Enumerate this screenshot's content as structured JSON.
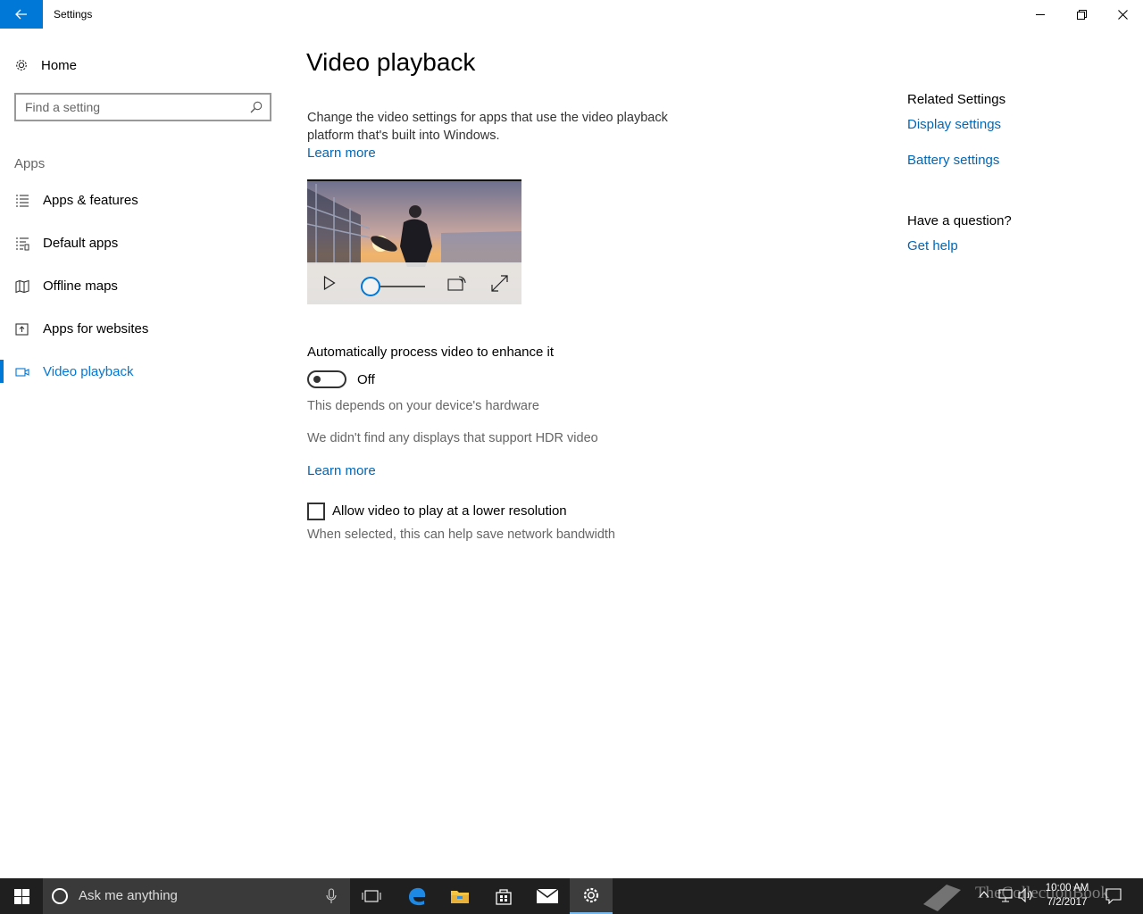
{
  "window": {
    "title": "Settings"
  },
  "sidebar": {
    "home_label": "Home",
    "search_placeholder": "Find a setting",
    "section_label": "Apps",
    "items": [
      {
        "label": "Apps & features",
        "icon": "list-icon"
      },
      {
        "label": "Default apps",
        "icon": "default-apps-icon"
      },
      {
        "label": "Offline maps",
        "icon": "map-icon"
      },
      {
        "label": "Apps for websites",
        "icon": "open-in-app-icon"
      },
      {
        "label": "Video playback",
        "icon": "video-camera-icon",
        "active": true
      }
    ]
  },
  "main": {
    "title": "Video playback",
    "description": "Change the video settings for apps that use the video playback platform that's built into Windows.",
    "learn_more_1": "Learn more",
    "auto_process": {
      "heading": "Automatically process video to enhance it",
      "state": "Off",
      "hardware_note": "This depends on your device's hardware"
    },
    "hdr_note": "We didn't find any displays that support HDR video",
    "learn_more_2": "Learn more",
    "lower_res": {
      "label": "Allow video to play at a lower resolution",
      "checked": false,
      "note": "When selected, this can help save network bandwidth"
    }
  },
  "related": {
    "heading": "Related Settings",
    "links": [
      "Display settings",
      "Battery settings"
    ],
    "question_heading": "Have a question?",
    "help_link": "Get help"
  },
  "taskbar": {
    "search_placeholder": "Ask me anything",
    "time": "10:00 AM",
    "date": "7/2/2017",
    "watermark": "TheCollectionBook"
  },
  "colors": {
    "accent": "#0078d7",
    "link": "#0067b8",
    "taskbar": "#1f1f1f"
  }
}
